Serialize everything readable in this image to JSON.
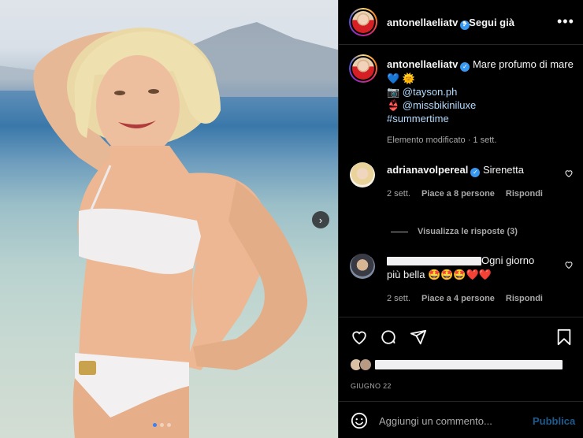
{
  "post": {
    "username": "antonellaeliatv",
    "follow_state": "• Segui già",
    "more_label": "•••",
    "caption_text": "Mare profumo di mare💙 🌞",
    "caption_line2": "📷 @tayson.ph",
    "caption_line3": "👙 @missbikiniluxe",
    "caption_hashtag": "#summertime",
    "edited_meta": "Elemento modificato · 1 sett.",
    "carousel_next": "›"
  },
  "comments": [
    {
      "username": "adrianavolpereal",
      "text": "Sirenetta",
      "age": "2 sett.",
      "likes": "Piace a 8 persone",
      "reply": "Rispondi",
      "view_replies": "Visualizza le risposte (3)"
    },
    {
      "username": "",
      "text_a": "Ogni giorno",
      "text_b": "più bella 🤩🤩🤩❤️❤️",
      "age": "2 sett.",
      "likes": "Piace a 4 persone",
      "reply": "Rispondi"
    }
  ],
  "footer": {
    "date": "GIUGNO 22",
    "comment_placeholder": "Aggiungi un commento...",
    "publish": "Pubblica"
  },
  "icons": {
    "like": "heart-icon",
    "comment": "comment-icon",
    "share": "send-icon",
    "save": "bookmark-icon",
    "emoji": "smiley-icon"
  },
  "colors": {
    "background": "#000000",
    "text": "#f5f5f5",
    "muted": "#a8a8a8",
    "verified": "#3897f0",
    "publish_disabled": "#1d5b8f",
    "carousel_active_dot": "#3b82f6"
  },
  "carousel": {
    "slides": 3,
    "active": 1
  }
}
